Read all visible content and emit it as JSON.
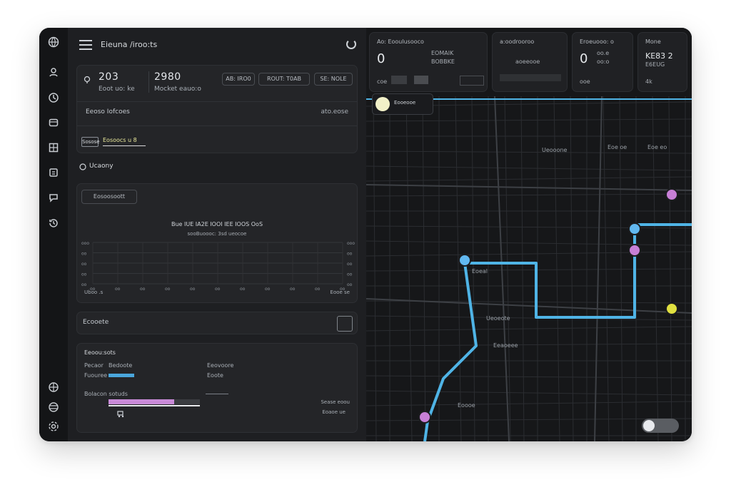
{
  "app": {
    "title": "Eieuna /iroo:ts"
  },
  "summary": {
    "metric1_value": "203",
    "metric1_label": "Eoot uo: ke",
    "metric2_value": "2980",
    "metric2_label": "Mocket eauo:o",
    "buttons": [
      "AB: IRO0",
      "ROUT: T0AB",
      "SE: NOLE"
    ],
    "section_label": "Eeoso Iofcoes",
    "section_value": "ato.eose",
    "tag_label": "Sosose",
    "tag_value": "Eosoocs u 8"
  },
  "history": {
    "label": "Ucaony"
  },
  "chart_card": {
    "chip_label": "Eosoosoott",
    "title": "Bue IUE IA2E IOOI IEE IOOS OoS",
    "subtitle": "sooBuoooc: 3sd ueocoe",
    "y_ticks_left": [
      "ooo",
      "oo",
      "oo",
      "oo",
      "oo"
    ],
    "y_ticks_right": [
      "ooo",
      "oo",
      "oo",
      "oo",
      "oo"
    ],
    "x_ticks": [
      "oo",
      "oo",
      "oo",
      "oo",
      "oo",
      "oo",
      "oo",
      "oo",
      "oo",
      "oo",
      "oo"
    ],
    "x_left_label": "Uboo .s",
    "x_right_label": "Eooe se"
  },
  "status_bar": {
    "label": "Ecooete"
  },
  "details": {
    "title": "Eeoou:sots",
    "row1_label": "Pecaor",
    "row1_value": "Bedoote",
    "row2_label": "Fuouree",
    "row3_label": "Eeovoore",
    "row3_value": "Eoote",
    "row4_label": "Bolacon sotuds",
    "foot1": "Sease eoou",
    "foot2": "Eoaoe ue",
    "progress_purple": 0.72,
    "progress_blue": 0.5
  },
  "stats": [
    {
      "label": "Ao: Eooulusooco",
      "value": "0",
      "sub1": "EOMAIK",
      "sub2": "BOBBKE",
      "sub3": "coe"
    },
    {
      "label": "a:oodrooroo",
      "value": "",
      "sub1": "aoeeooe",
      "sub2": "",
      "sub3": ""
    },
    {
      "label": "Eroeuooo: o",
      "value": "0",
      "sub1": "oo.e",
      "sub2": "oo:o",
      "sub3": "ooe"
    },
    {
      "label": "Mone",
      "value": "KE83 2",
      "sub1": "E6EUG",
      "sub2": "",
      "sub3": "4k"
    }
  ],
  "map": {
    "legend_text": "Eooeooe",
    "labels": [
      "Ueooone",
      "Eoe oe",
      "Eoe eo",
      "Eoeal",
      "Ueoeote",
      "Eeaoeee",
      "Eoooe"
    ],
    "colors": {
      "route": "#4fb4e6",
      "pin_purple": "#c77fd6",
      "pin_yellow": "#e0e040",
      "pin_blue": "#61b8f0"
    }
  },
  "icons": [
    "globe-icon",
    "user-icon",
    "clock-icon",
    "box-icon",
    "grid-icon",
    "calendar-icon",
    "chat-icon",
    "history-icon",
    "language-icon",
    "globe-small-icon",
    "settings-icon"
  ]
}
